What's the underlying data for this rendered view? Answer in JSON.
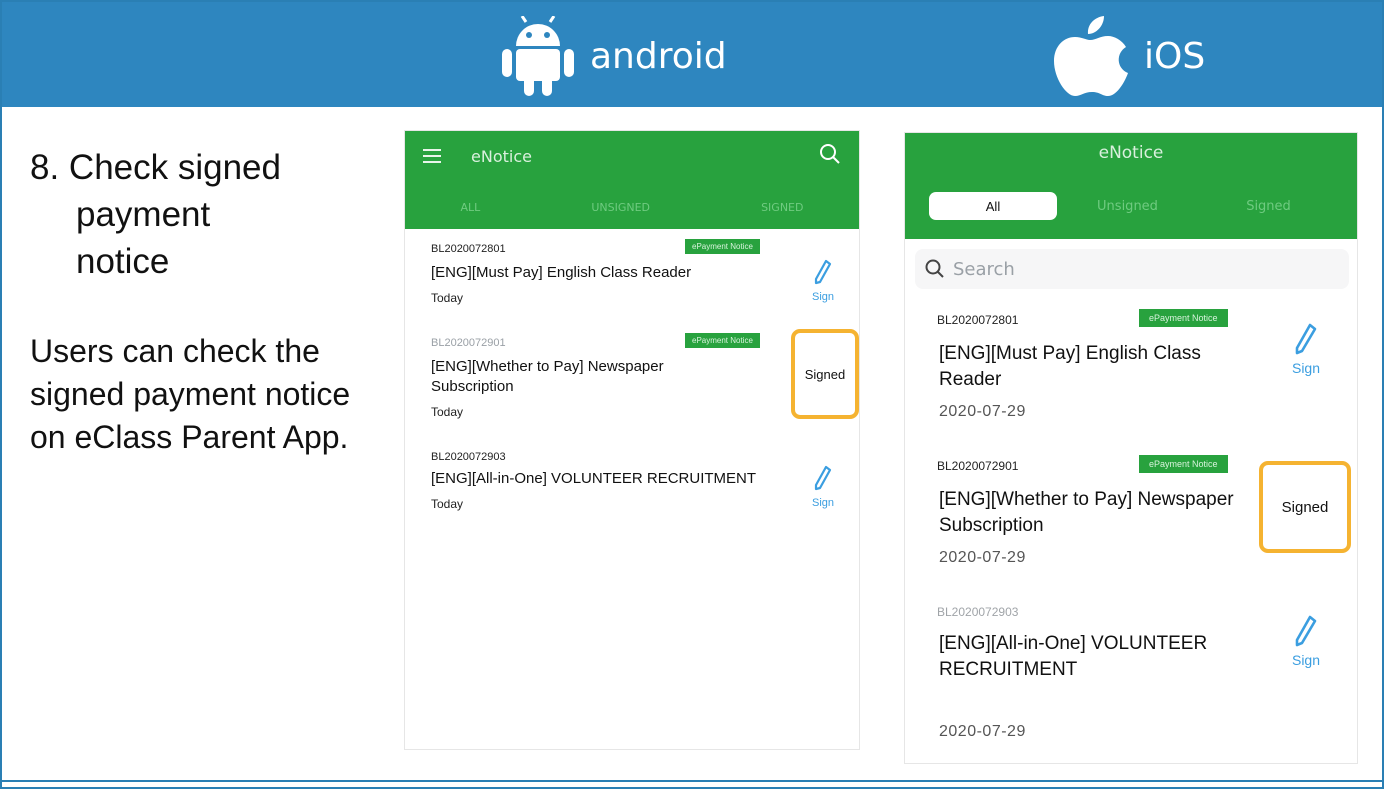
{
  "banner": {
    "android_label": "android",
    "ios_label": "iOS",
    "color": "#2e86bf"
  },
  "step": {
    "title_line1": "8. Check signed",
    "title_line2": "payment",
    "title_line3": "notice",
    "description": "Users can check the signed payment notice on eClass Parent App."
  },
  "android": {
    "app_title": "eNotice",
    "tabs": [
      "ALL",
      "UNSIGNED",
      "SIGNED"
    ],
    "items": [
      {
        "code": "BL2020072801",
        "badge": "ePayment Notice",
        "name": "[ENG][Must Pay] English Class Reader",
        "date": "Today",
        "action": "Sign"
      },
      {
        "code": "BL2020072901",
        "badge": "ePayment Notice",
        "name": "[ENG][Whether to Pay] Newspaper Subscription",
        "date": "Today",
        "action": "Signed"
      },
      {
        "code": "BL2020072903",
        "name": "[ENG][All-in-One] VOLUNTEER RECRUITMENT",
        "date": "Today",
        "action": "Sign"
      }
    ]
  },
  "ios": {
    "app_title": "eNotice",
    "segments": [
      "All",
      "Unsigned",
      "Signed"
    ],
    "search_placeholder": "Search",
    "items": [
      {
        "code": "BL2020072801",
        "badge": "ePayment Notice",
        "name": "[ENG][Must Pay] English Class Reader",
        "date": "2020-07-29",
        "action": "Sign"
      },
      {
        "code": "BL2020072901",
        "badge": "ePayment Notice",
        "name": "[ENG][Whether to Pay] Newspaper Subscription",
        "date": "2020-07-29",
        "action": "Signed"
      },
      {
        "code": "BL2020072903",
        "name": "[ENG][All-in-One] VOLUNTEER RECRUITMENT",
        "date": "2020-07-29",
        "action": "Sign"
      }
    ]
  },
  "colors": {
    "app_green": "#28a23e",
    "highlight": "#f5b331",
    "sign_blue": "#3b9ee0"
  }
}
